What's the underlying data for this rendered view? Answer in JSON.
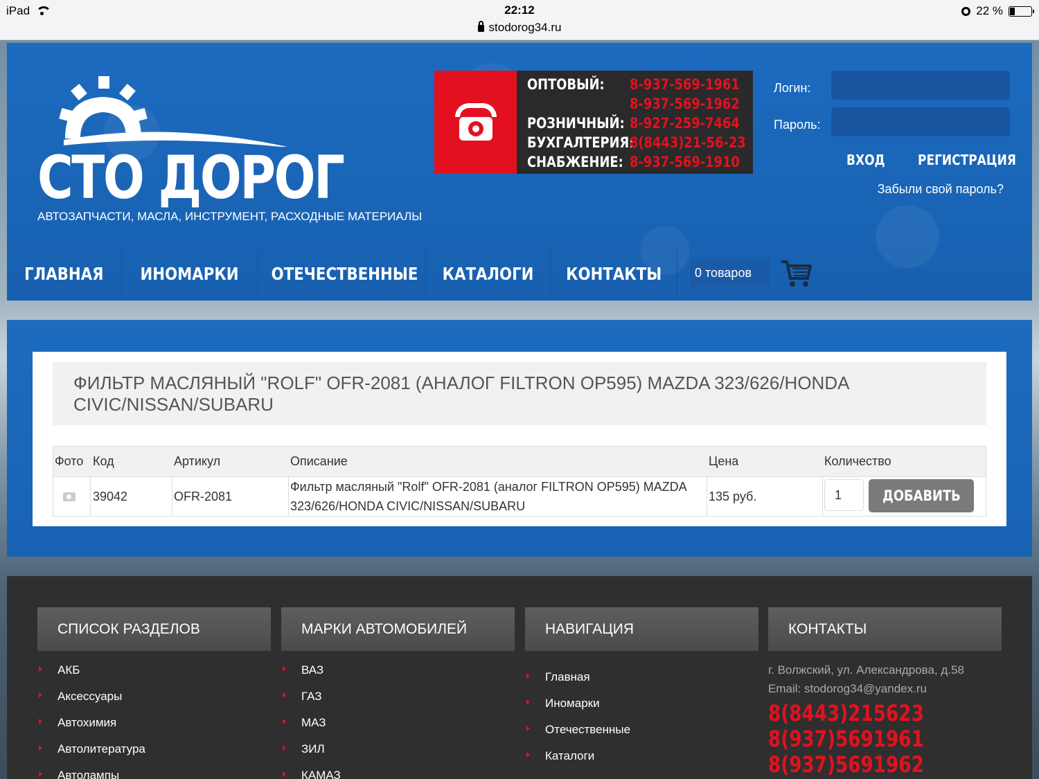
{
  "status_bar": {
    "device": "iPad",
    "time": "22:12",
    "url": "stodorog34.ru",
    "battery": "22 %",
    "battery_level": 0.22
  },
  "header": {
    "logo_text": "СТО ДОРОГ",
    "tagline": "АВТОЗАПЧАСТИ, МАСЛА, ИНСТРУМЕНТ, РАСХОДНЫЕ МАТЕРИАЛЫ",
    "phones": [
      {
        "label": "ОПТОВЫЙ:",
        "number": "8-937-569-1961"
      },
      {
        "label": "",
        "number": "8-937-569-1962"
      },
      {
        "label": "РОЗНИЧНЫЙ:",
        "number": "8-927-259-7464"
      },
      {
        "label": "БУХГАЛТЕРИЯ:",
        "number": "8(8443)21-56-23"
      },
      {
        "label": "СНАБЖЕНИЕ:",
        "number": "8-937-569-1910"
      }
    ],
    "login_label": "Логин:",
    "password_label": "Пароль:",
    "login_value": "",
    "password_value": "",
    "enter_label": "ВХОД",
    "register_label": "РЕГИСТРАЦИЯ",
    "forgot_label": "Забыли свой пароль?"
  },
  "nav": {
    "items": [
      "ГЛАВНАЯ",
      "ИНОМАРКИ",
      "ОТЕЧЕСТВЕННЫЕ",
      "КАТАЛОГИ",
      "КОНТАКТЫ"
    ],
    "active_index": 2,
    "cart_label": "0 товаров"
  },
  "product": {
    "title": "ФИЛЬТР МАСЛЯНЫЙ \"ROLF\" OFR-2081 (АНАЛОГ FILTRON OP595) MAZDA 323/626/HONDA CIVIC/NISSAN/SUBARU",
    "columns": [
      "Фото",
      "Код",
      "Артикул",
      "Описание",
      "Цена",
      "Количество"
    ],
    "row": {
      "code": "39042",
      "article": "OFR-2081",
      "description": "Фильтр масляный \"Rolf\" OFR-2081 (аналог FILTRON OP595) MAZDA 323/626/HONDA CIVIC/NISSAN/SUBARU",
      "price": "135 руб.",
      "quantity": "1"
    },
    "add_label": "ДОБАВИТЬ"
  },
  "footer": {
    "sections": {
      "title": "СПИСОК РАЗДЕЛОВ",
      "items": [
        "АКБ",
        "Аксессуары",
        "Автохимия",
        "Автолитература",
        "Автолампы"
      ]
    },
    "brands": {
      "title": "МАРКИ АВТОМОБИЛЕЙ",
      "items": [
        "ВАЗ",
        "ГАЗ",
        "МАЗ",
        "ЗИЛ",
        "КАМАЗ"
      ]
    },
    "navigation": {
      "title": "НАВИГАЦИЯ",
      "items": [
        "Главная",
        "Иномарки",
        "Отечественные",
        "Каталоги"
      ]
    },
    "contacts": {
      "title": "КОНТАКТЫ",
      "address": "г. Волжский, ул. Александрова, д.58",
      "email": "Email: stodorog34@yandex.ru",
      "phones": [
        "8(8443)215623",
        "8(937)5691961",
        "8(937)5691962"
      ]
    }
  },
  "colors": {
    "brand_blue": "#1b67b9",
    "accent_red": "#e3111f",
    "footer_dark": "#2f2f2f"
  }
}
